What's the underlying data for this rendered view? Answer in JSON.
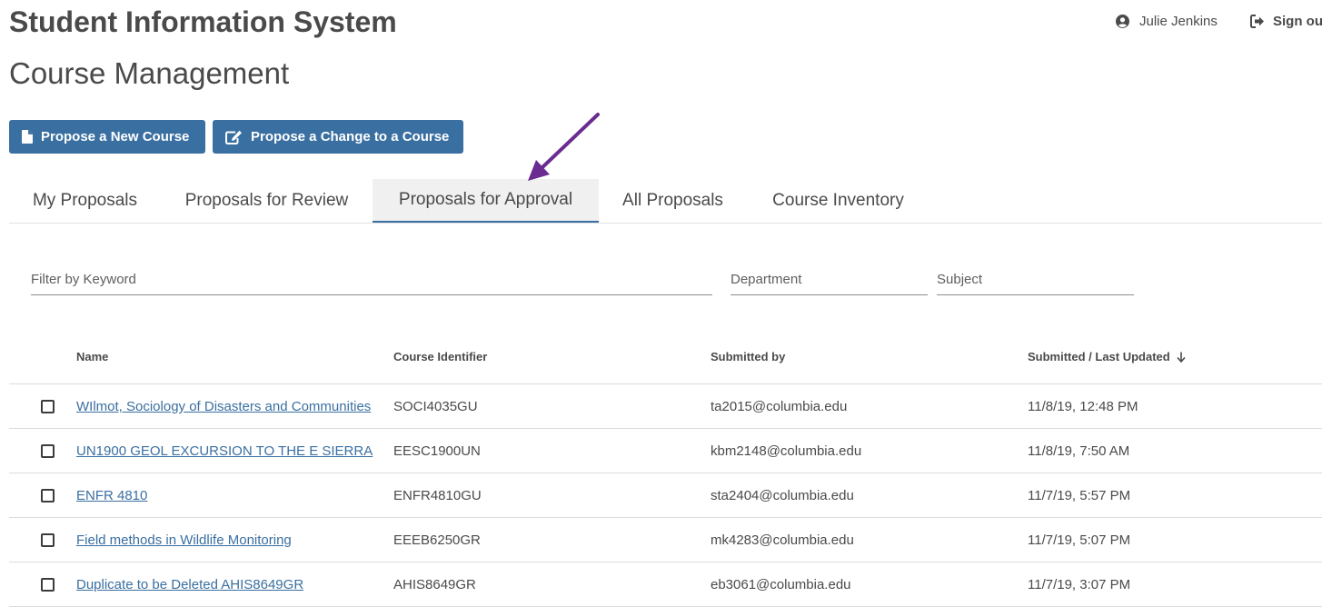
{
  "header": {
    "app_title": "Student Information System",
    "user_name": "Julie Jenkins",
    "user_icon": "user-circle-icon",
    "signout_label": "Sign ou",
    "signout_icon": "sign-out-icon"
  },
  "page": {
    "title": "Course Management"
  },
  "actions": {
    "propose_new_label": "Propose a New Course",
    "propose_new_icon": "file-icon",
    "propose_change_label": "Propose a Change to a Course",
    "propose_change_icon": "edit-icon",
    "button_color": "#3a6fa1"
  },
  "tabs": [
    {
      "label": "My Proposals",
      "active": false
    },
    {
      "label": "Proposals for Review",
      "active": false
    },
    {
      "label": "Proposals for Approval",
      "active": true
    },
    {
      "label": "All Proposals",
      "active": false
    },
    {
      "label": "Course Inventory",
      "active": false
    }
  ],
  "annotation": {
    "arrow_color": "#6a2c91",
    "arrow_points_to": "Proposals for Approval"
  },
  "filters": {
    "keyword_placeholder": "Filter by Keyword",
    "department_placeholder": "Department",
    "subject_placeholder": "Subject"
  },
  "table": {
    "columns": {
      "name": "Name",
      "course_identifier": "Course Identifier",
      "submitted_by": "Submitted by",
      "submitted_last_updated": "Submitted / Last Updated"
    },
    "sort_icon": "arrow-down-icon",
    "rows": [
      {
        "name": "WIlmot, Sociology of Disasters and Communities",
        "course_identifier": "SOCI4035GU",
        "submitted_by": "ta2015@columbia.edu",
        "updated": "11/8/19, 12:48 PM",
        "checked": false
      },
      {
        "name": "UN1900 GEOL EXCURSION TO THE E SIERRA",
        "course_identifier": "EESC1900UN",
        "submitted_by": "kbm2148@columbia.edu",
        "updated": "11/8/19, 7:50 AM",
        "checked": false
      },
      {
        "name": "ENFR 4810",
        "course_identifier": "ENFR4810GU",
        "submitted_by": "sta2404@columbia.edu",
        "updated": "11/7/19, 5:57 PM",
        "checked": false
      },
      {
        "name": "Field methods in Wildlife Monitoring",
        "course_identifier": "EEEB6250GR",
        "submitted_by": "mk4283@columbia.edu",
        "updated": "11/7/19, 5:07 PM",
        "checked": false
      },
      {
        "name": "Duplicate to be Deleted AHIS8649GR",
        "course_identifier": "AHIS8649GR",
        "submitted_by": "eb3061@columbia.edu",
        "updated": "11/7/19, 3:07 PM",
        "checked": false
      }
    ]
  }
}
